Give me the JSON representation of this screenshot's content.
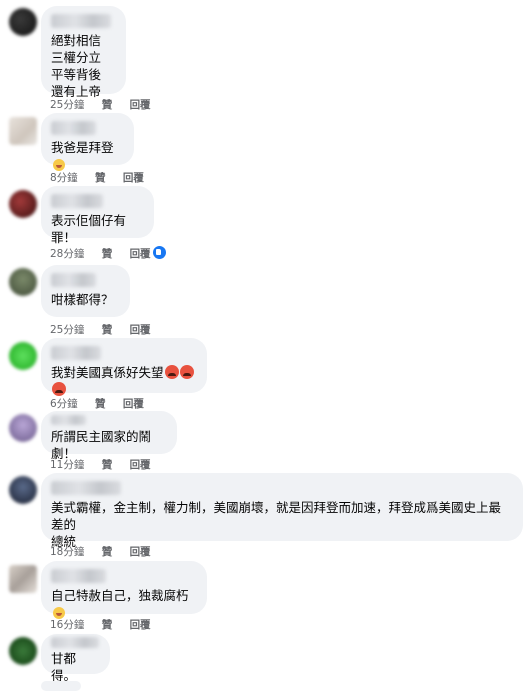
{
  "actions": {
    "like": "贊",
    "reply": "回覆"
  },
  "colors": {
    "bubble": "#f0f2f5",
    "meta": "#65676b",
    "like_badge": "#1877f2"
  },
  "comments": [
    {
      "lines": [
        "絕對相信",
        "三權分立",
        "平等背後",
        "還有上帝"
      ],
      "time": "25分鐘"
    },
    {
      "lines": [
        "我爸是拜登"
      ],
      "emoji": "laughing-emoji",
      "time": "8分鐘"
    },
    {
      "lines": [
        "表示佢個仔有罪！"
      ],
      "time": "28分鐘",
      "reaction": "like-reaction"
    },
    {
      "lines": [
        "咁樣都得？"
      ],
      "time": "25分鐘"
    },
    {
      "lines": [
        "我對美國真係好失望"
      ],
      "emoji": "angry-emoji",
      "time": "6分鐘"
    },
    {
      "lines": [
        "所謂民主國家的鬧劇！"
      ],
      "time": "11分鐘"
    },
    {
      "lines": [
        "美式霸權，金主制，權力制，美國崩壞，就是因拜登而加速，拜登成爲美國史上最差的",
        "總統"
      ],
      "time": "18分鐘"
    },
    {
      "lines": [
        "自己特赦自己，独裁腐朽"
      ],
      "emoji": "laughing-emoji",
      "time": "16分鐘"
    },
    {
      "lines": [
        "甘都得。"
      ],
      "time": ""
    }
  ]
}
